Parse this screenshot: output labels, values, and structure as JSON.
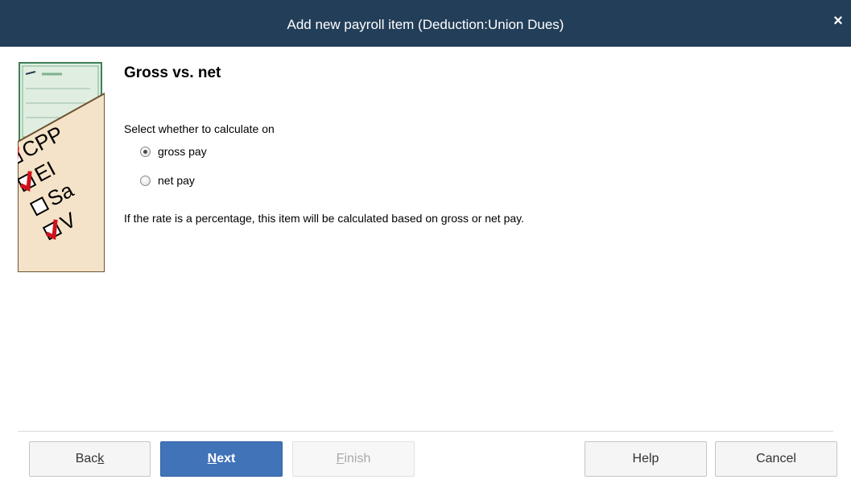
{
  "window": {
    "title": "Add new payroll item (Deduction:Union Dues)",
    "close_glyph": "×"
  },
  "illustration": {
    "items": [
      "CPP",
      "EI",
      "Sa",
      "V"
    ],
    "checked": [
      true,
      true,
      false,
      true
    ]
  },
  "page": {
    "heading": "Gross vs. net",
    "prompt": "Select whether to calculate on",
    "options": [
      {
        "label": "gross pay",
        "selected": true
      },
      {
        "label": "net pay",
        "selected": false
      }
    ],
    "note": "If the rate is a percentage, this item will be calculated based on gross or net pay."
  },
  "buttons": {
    "back": {
      "pre": "Bac",
      "mnemonic": "k",
      "post": ""
    },
    "next": {
      "pre": "",
      "mnemonic": "N",
      "post": "ext"
    },
    "finish": {
      "pre": "",
      "mnemonic": "F",
      "post": "inish"
    },
    "help": "Help",
    "cancel": "Cancel"
  },
  "colors": {
    "titlebar": "#233e59",
    "primary_button": "#4173b9",
    "check_red": "#d0121b"
  }
}
